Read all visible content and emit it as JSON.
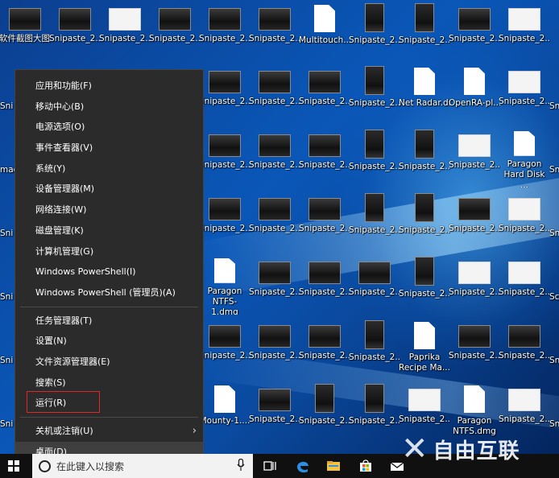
{
  "desktop_icons": [
    {
      "label": "软件截图大图标示例",
      "kind": "landscape"
    },
    {
      "label": "Snipaste_2...",
      "kind": "landscape"
    },
    {
      "label": "Snipaste_2...",
      "kind": "white"
    },
    {
      "label": "Snipaste_2...",
      "kind": "landscape"
    },
    {
      "label": "Snipaste_2...",
      "kind": "landscape"
    },
    {
      "label": "Snipaste_2...",
      "kind": "landscape"
    },
    {
      "label": "Multitouch...",
      "kind": "file"
    },
    {
      "label": "Snipaste_2...",
      "kind": "portrait"
    },
    {
      "label": "Snipaste_2...",
      "kind": "portrait"
    },
    {
      "label": "Snipaste_2...",
      "kind": "landscape"
    },
    {
      "label": "Snipaste_2...",
      "kind": "white"
    },
    {
      "label": "Snipaste_2...",
      "kind": "landscape"
    },
    {
      "label": "Snipaste_2...",
      "kind": "landscape"
    },
    {
      "label": "Snipaste_2...",
      "kind": "landscape"
    },
    {
      "label": "Snipaste_2...",
      "kind": "portrait"
    },
    {
      "label": "Net Radar.dmg",
      "kind": "file"
    },
    {
      "label": "OpenRA-pl...",
      "kind": "file"
    },
    {
      "label": "Snipaste_2...",
      "kind": "white"
    },
    {
      "label": "Snipaste_2...",
      "kind": "landscape"
    },
    {
      "label": "Snipaste_2...",
      "kind": "landscape"
    },
    {
      "label": "Snipaste_2...",
      "kind": "landscape"
    },
    {
      "label": "Snipaste_2...",
      "kind": "portrait"
    },
    {
      "label": "Snipaste_2...",
      "kind": "portrait"
    },
    {
      "label": "Snipaste_2...",
      "kind": "white"
    },
    {
      "label": "Paragon Hard Disk ...",
      "kind": "file"
    },
    {
      "label": "Snipaste_2...",
      "kind": "landscape"
    },
    {
      "label": "Snipaste_2...",
      "kind": "landscape"
    },
    {
      "label": "Snipaste_2...",
      "kind": "landscape"
    },
    {
      "label": "Snipaste_2...",
      "kind": "portrait"
    },
    {
      "label": "Snipaste_2...",
      "kind": "portrait"
    },
    {
      "label": "Snipaste_2...",
      "kind": "landscape"
    },
    {
      "label": "Snipaste_2...",
      "kind": "white"
    },
    {
      "label": "Paragon NTFS-1.dmg",
      "kind": "file"
    },
    {
      "label": "Snipaste_2...",
      "kind": "landscape"
    },
    {
      "label": "Snipaste_2...",
      "kind": "landscape"
    },
    {
      "label": "Snipaste_2...",
      "kind": "landscape"
    },
    {
      "label": "Snipaste_2...",
      "kind": "portrait"
    },
    {
      "label": "Snipaste_2...",
      "kind": "white"
    },
    {
      "label": "Snipaste_2...",
      "kind": "white"
    },
    {
      "label": "Snipaste_2...",
      "kind": "landscape"
    },
    {
      "label": "Snipaste_2...",
      "kind": "landscape"
    },
    {
      "label": "Snipaste_2...",
      "kind": "landscape"
    },
    {
      "label": "Snipaste_2...",
      "kind": "portrait"
    },
    {
      "label": "Paprika Recipe Ma...",
      "kind": "file"
    },
    {
      "label": "Snipaste_2...",
      "kind": "landscape"
    },
    {
      "label": "Snipaste_2...",
      "kind": "landscape"
    },
    {
      "label": "Mounty-1....",
      "kind": "file"
    },
    {
      "label": "Snipaste_2...",
      "kind": "landscape"
    },
    {
      "label": "Snipaste_2...",
      "kind": "portrait"
    },
    {
      "label": "Snipaste_2...",
      "kind": "portrait"
    },
    {
      "label": "Snipaste_2...",
      "kind": "white"
    },
    {
      "label": "Paragon NTFS.dmg",
      "kind": "file"
    },
    {
      "label": "Snipaste_2...",
      "kind": "white"
    }
  ],
  "left_edge_labels": [
    "Sni",
    "mac",
    "Sni",
    "Sni",
    "Sni",
    "Sni"
  ],
  "right_edge_labels": [
    "Sni",
    "Sni",
    "Sni",
    "Sc",
    "Sni",
    "Sni"
  ],
  "menu": {
    "group1": [
      "应用和功能(F)",
      "移动中心(B)",
      "电源选项(O)",
      "事件查看器(V)",
      "系统(Y)",
      "设备管理器(M)",
      "网络连接(W)",
      "磁盘管理(K)",
      "计算机管理(G)",
      "Windows PowerShell(I)",
      "Windows PowerShell (管理员)(A)"
    ],
    "group2": [
      "任务管理器(T)",
      "设置(N)",
      "文件资源管理器(E)",
      "搜索(S)",
      "运行(R)"
    ],
    "shutdown": "关机或注销(U)",
    "desktop": "桌面(D)",
    "submenu_arrow": "›"
  },
  "taskbar": {
    "search_placeholder": "在此键入以搜索",
    "mic_icon": "microphone-icon",
    "icons": [
      "task-view-icon",
      "edge-icon",
      "file-explorer-icon",
      "store-icon",
      "mail-icon"
    ]
  },
  "watermark": {
    "text": "自由互联"
  },
  "colors": {
    "menu_bg": "#2b2b2b",
    "highlight": "#e0262b",
    "taskbar": "#101010"
  }
}
